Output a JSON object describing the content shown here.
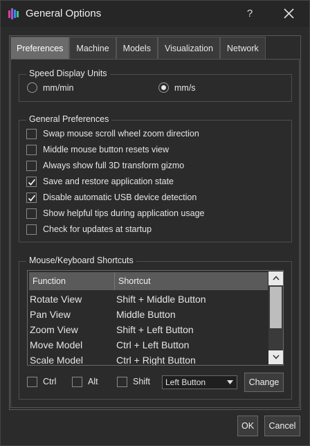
{
  "window": {
    "title": "General Options",
    "help_label": "?"
  },
  "tabs": [
    "Preferences",
    "Machine",
    "Models",
    "Visualization",
    "Network"
  ],
  "speed_units": {
    "title": "Speed Display Units",
    "options": [
      {
        "label": "mm/min",
        "checked": false
      },
      {
        "label": "mm/s",
        "checked": true
      }
    ]
  },
  "general_preferences": {
    "title": "General Preferences",
    "items": [
      {
        "label": "Swap mouse scroll wheel zoom direction",
        "checked": false
      },
      {
        "label": "Middle mouse button resets view",
        "checked": false
      },
      {
        "label": "Always show full 3D transform gizmo",
        "checked": false
      },
      {
        "label": "Save and restore application state",
        "checked": true
      },
      {
        "label": "Disable automatic USB device detection",
        "checked": true
      },
      {
        "label": "Show helpful tips during application usage",
        "checked": false
      },
      {
        "label": "Check for updates at startup",
        "checked": false
      }
    ]
  },
  "shortcuts": {
    "title": "Mouse/Keyboard Shortcuts",
    "columns": [
      "Function",
      "Shortcut"
    ],
    "rows": [
      [
        "Rotate View",
        "Shift + Middle Button"
      ],
      [
        "Pan View",
        "Middle Button"
      ],
      [
        "Zoom View",
        "Shift + Left Button"
      ],
      [
        "Move Model",
        "Ctrl + Left Button"
      ],
      [
        "Scale Model",
        "Ctrl + Right Button"
      ]
    ],
    "modifiers": [
      {
        "label": "Ctrl",
        "checked": false
      },
      {
        "label": "Alt",
        "checked": false
      },
      {
        "label": "Shift",
        "checked": false
      }
    ],
    "button_select": "Left Button",
    "change_label": "Change"
  },
  "footer": {
    "ok_label": "OK",
    "cancel_label": "Cancel"
  },
  "colors": {
    "background": "#2b2b2b",
    "active_tab": "#6b6b6b",
    "header": "#5a5a5a"
  }
}
